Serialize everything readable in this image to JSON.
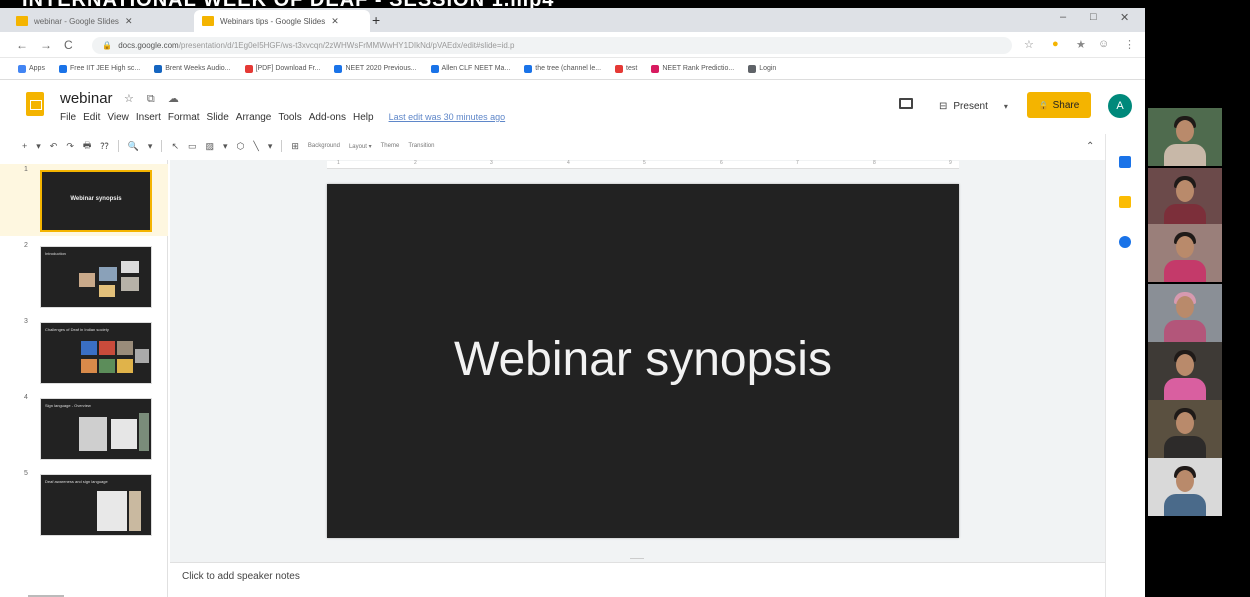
{
  "video": {
    "title": "INTERNATIONAL WEEK OF DEAF - SESSION 1.mp4"
  },
  "browser": {
    "tabs": [
      {
        "label": "webinar - Google Slides"
      },
      {
        "label": "Webinars tips - Google Slides"
      }
    ],
    "new_tab": "+",
    "window_controls": [
      "–",
      "□",
      "✕"
    ],
    "nav": {
      "back": "←",
      "forward": "→",
      "reload": "C"
    },
    "url": "docs.google.com",
    "url_path": "/presentation/d/1Eg0eI5HGF/ws-t3xvcqn/2zWHWsFrMMWwHY1DIkNd/pVAEdx/edit#slide=id.p",
    "extensions": [
      "☆",
      "●",
      "★",
      "☺",
      "⋮"
    ],
    "bookmarks": [
      {
        "label": "Apps",
        "color": "#4285f4"
      },
      {
        "label": "Free IIT JEE High sc...",
        "color": "#1a73e8"
      },
      {
        "label": "Brent Weeks Audio...",
        "color": "#1565c0"
      },
      {
        "label": "[PDF] Download Fr...",
        "color": "#e53935"
      },
      {
        "label": "NEET 2020 Previous...",
        "color": "#1a73e8"
      },
      {
        "label": "Allen CLF NEET Ma...",
        "color": "#1a73e8"
      },
      {
        "label": "the tree (channel le...",
        "color": "#1a73e8"
      },
      {
        "label": "test",
        "color": "#e53935"
      },
      {
        "label": "NEET Rank Predictio...",
        "color": "#d81b60"
      },
      {
        "label": "Login",
        "color": "#5f6368"
      }
    ]
  },
  "app": {
    "doc_name": "webinar",
    "doc_icons": "☆ ⧉ ☁",
    "menu": [
      "File",
      "Edit",
      "View",
      "Insert",
      "Format",
      "Slide",
      "Arrange",
      "Tools",
      "Add-ons",
      "Help"
    ],
    "last_edit": "Last edit was 30 minutes ago",
    "present_label": "Present",
    "present_dropdown": "▾",
    "share_label": "Share",
    "share_icon": "🔒",
    "avatar_letter": "A",
    "toolbar_icons": [
      "+",
      "▾",
      "↶",
      "↷",
      "🖶",
      "⁇",
      "🔍",
      "▾",
      "↖",
      "▭",
      "▨",
      "▾",
      "⬡",
      "╲",
      "▾",
      "⊞"
    ],
    "toolbar_text": [
      "Background",
      "Layout ▾",
      "Theme",
      "Transition"
    ],
    "collapse_icon": "⌃"
  },
  "filmstrip": [
    {
      "num": "1",
      "title": "Webinar synopsis"
    },
    {
      "num": "2",
      "title": "Introduction"
    },
    {
      "num": "3",
      "title": "Challenges of Deaf in Indian society"
    },
    {
      "num": "4",
      "title": "Sign language - Overview"
    },
    {
      "num": "5",
      "title": "Deaf awareness and sign language"
    }
  ],
  "ruler_marks": [
    "1",
    "2",
    "3",
    "4",
    "5",
    "6",
    "7",
    "8",
    "9"
  ],
  "slide": {
    "title": "Webinar synopsis",
    "background": "#222222"
  },
  "notes": {
    "placeholder": "Click to add speaker notes"
  },
  "colors": {
    "accent": "#f4b400",
    "avatar": "#00897b",
    "slide_bg": "#222222"
  },
  "side_icons": [
    "calendar-icon",
    "keep-icon",
    "tasks-icon"
  ],
  "participants_count": 7
}
